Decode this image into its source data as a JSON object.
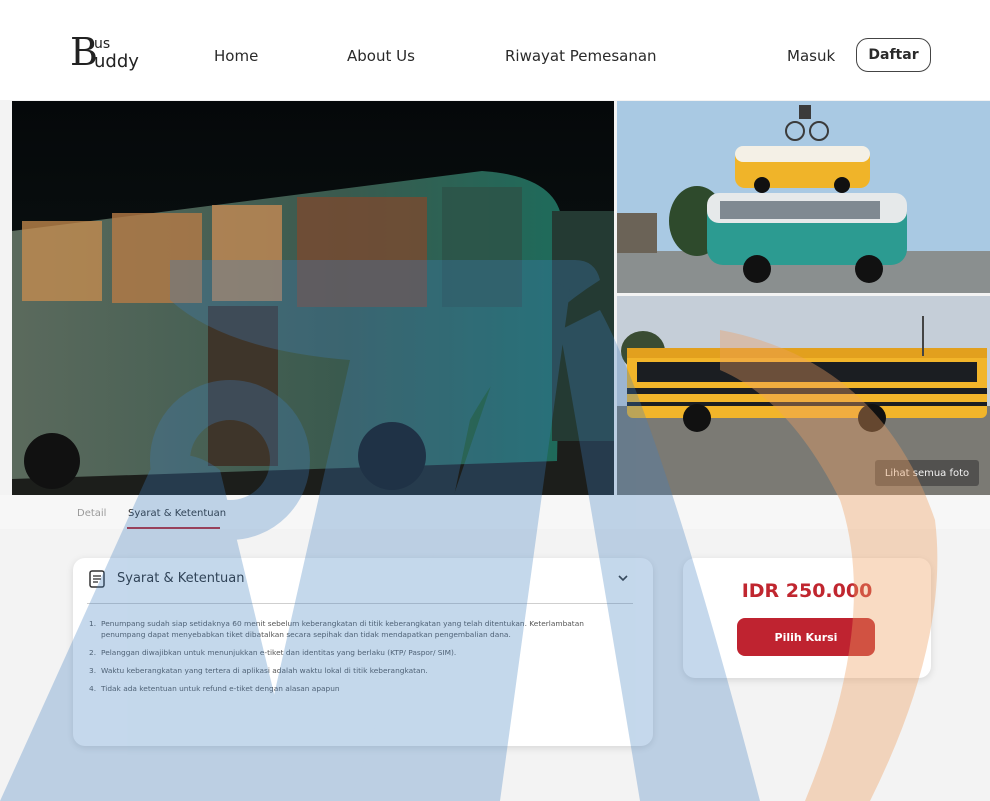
{
  "brand": {
    "logo_b": "B",
    "logo_us": "us",
    "logo_uddy": "uddy"
  },
  "nav": {
    "home": "Home",
    "about": "About Us",
    "history": "Riwayat Pemesanan",
    "login": "Masuk",
    "register": "Daftar"
  },
  "gallery": {
    "see_all": "Lihat semua foto"
  },
  "tabs": {
    "detail": "Detail",
    "terms": "Syarat & Ketentuan",
    "active": "terms"
  },
  "terms": {
    "title": "Syarat & Ketentuan",
    "items": [
      {
        "num": "1.",
        "text": "Penumpang sudah siap setidaknya 60 menit sebelum keberangkatan di titik keberangkatan yang telah ditentukan. Keterlambatan penumpang dapat menyebabkan tiket dibatalkan secara sepihak dan tidak mendapatkan pengembalian dana."
      },
      {
        "num": "2.",
        "text": "Pelanggan diwajibkan untuk menunjukkan e-tiket dan identitas yang berlaku (KTP/ Paspor/ SIM)."
      },
      {
        "num": "3.",
        "text": "Waktu keberangkatan yang tertera di aplikasi adalah waktu lokal di titik keberangkatan."
      },
      {
        "num": "4.",
        "text": "Tidak ada ketentuan untuk refund e-tiket dengan alasan apapun"
      }
    ]
  },
  "booking": {
    "price": "IDR 250.000",
    "select_seat": "Pilih Kursi"
  },
  "colors": {
    "accent": "#c0262f",
    "watermark_blue": "#3f7fc0",
    "watermark_orange": "#f0a060"
  }
}
